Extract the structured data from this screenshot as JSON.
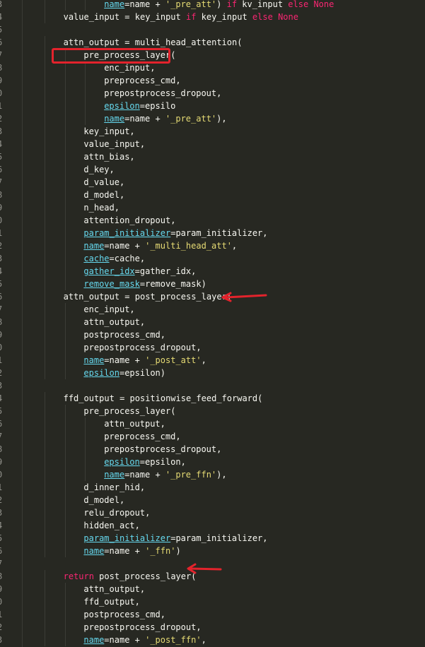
{
  "editor": {
    "language": "python",
    "theme": "dark",
    "colors": {
      "background": "#272822",
      "keyword": "#f92672",
      "param": "#66d9ef",
      "string": "#e6db74",
      "annotation": "#e3232c"
    },
    "line_numbers": [
      "3",
      "4",
      "5",
      "6",
      "7",
      "8",
      "9",
      "0",
      "1",
      "2",
      "3",
      "4",
      "5",
      "6",
      "7",
      "8",
      "9",
      "0",
      "1",
      "2",
      "3",
      "4",
      "5",
      "6",
      "7",
      "8",
      "9",
      "0",
      "1",
      "2",
      "3",
      "4",
      "5",
      "6",
      "7",
      "8",
      "9",
      "0",
      "1",
      "2",
      "3",
      "4",
      "5",
      "6",
      "7",
      "8",
      "9",
      "0",
      "1",
      "2",
      "3",
      "4",
      "5",
      "6"
    ],
    "lines": [
      {
        "indent": 16,
        "segments": [
          {
            "t": "name",
            "c": "param"
          },
          {
            "t": "=name + ",
            "c": "op"
          },
          {
            "t": "'_pre_att'",
            "c": "str"
          },
          {
            "t": ") ",
            "c": "op"
          },
          {
            "t": "if",
            "c": "kw"
          },
          {
            "t": " kv_input ",
            "c": "op"
          },
          {
            "t": "else",
            "c": "kw"
          },
          {
            "t": " ",
            "c": "op"
          },
          {
            "t": "None",
            "c": "kw"
          }
        ]
      },
      {
        "indent": 8,
        "segments": [
          {
            "t": "value_input = key_input ",
            "c": "op"
          },
          {
            "t": "if",
            "c": "kw"
          },
          {
            "t": " key_input ",
            "c": "op"
          },
          {
            "t": "else",
            "c": "kw"
          },
          {
            "t": " ",
            "c": "op"
          },
          {
            "t": "None",
            "c": "kw"
          }
        ]
      },
      {
        "indent": 0,
        "segments": []
      },
      {
        "indent": 8,
        "segments": [
          {
            "t": "attn_output = multi_head_attention(",
            "c": "op"
          }
        ]
      },
      {
        "indent": 12,
        "segments": [
          {
            "t": "pre_process_layer(",
            "c": "op"
          }
        ]
      },
      {
        "indent": 16,
        "segments": [
          {
            "t": "enc_input,",
            "c": "op"
          }
        ]
      },
      {
        "indent": 16,
        "segments": [
          {
            "t": "preprocess_cmd,",
            "c": "op"
          }
        ]
      },
      {
        "indent": 16,
        "segments": [
          {
            "t": "prepostprocess_dropout,",
            "c": "op"
          }
        ]
      },
      {
        "indent": 16,
        "segments": [
          {
            "t": "epsilon",
            "c": "param"
          },
          {
            "t": "=epsilo",
            "c": "op"
          }
        ]
      },
      {
        "indent": 16,
        "segments": [
          {
            "t": "name",
            "c": "param"
          },
          {
            "t": "=name + ",
            "c": "op"
          },
          {
            "t": "'_pre_att'",
            "c": "str"
          },
          {
            "t": "),",
            "c": "op"
          }
        ]
      },
      {
        "indent": 12,
        "segments": [
          {
            "t": "key_input,",
            "c": "op"
          }
        ]
      },
      {
        "indent": 12,
        "segments": [
          {
            "t": "value_input,",
            "c": "op"
          }
        ]
      },
      {
        "indent": 12,
        "segments": [
          {
            "t": "attn_bias,",
            "c": "op"
          }
        ]
      },
      {
        "indent": 12,
        "segments": [
          {
            "t": "d_key,",
            "c": "op"
          }
        ]
      },
      {
        "indent": 12,
        "segments": [
          {
            "t": "d_value,",
            "c": "op"
          }
        ]
      },
      {
        "indent": 12,
        "segments": [
          {
            "t": "d_model,",
            "c": "op"
          }
        ]
      },
      {
        "indent": 12,
        "segments": [
          {
            "t": "n_head,",
            "c": "op"
          }
        ]
      },
      {
        "indent": 12,
        "segments": [
          {
            "t": "attention_dropout,",
            "c": "op"
          }
        ]
      },
      {
        "indent": 12,
        "segments": [
          {
            "t": "param_initializer",
            "c": "param"
          },
          {
            "t": "=param_initializer,",
            "c": "op"
          }
        ]
      },
      {
        "indent": 12,
        "segments": [
          {
            "t": "name",
            "c": "param"
          },
          {
            "t": "=name + ",
            "c": "op"
          },
          {
            "t": "'_multi_head_att'",
            "c": "str"
          },
          {
            "t": ",",
            "c": "op"
          }
        ]
      },
      {
        "indent": 12,
        "segments": [
          {
            "t": "cache",
            "c": "param"
          },
          {
            "t": "=cache,",
            "c": "op"
          }
        ]
      },
      {
        "indent": 12,
        "segments": [
          {
            "t": "gather_idx",
            "c": "param"
          },
          {
            "t": "=gather_idx,",
            "c": "op"
          }
        ]
      },
      {
        "indent": 12,
        "segments": [
          {
            "t": "remove_mask",
            "c": "param"
          },
          {
            "t": "=remove_mask)",
            "c": "op"
          }
        ]
      },
      {
        "indent": 8,
        "segments": [
          {
            "t": "attn_output = post_process_layer(",
            "c": "op"
          }
        ]
      },
      {
        "indent": 12,
        "segments": [
          {
            "t": "enc_input,",
            "c": "op"
          }
        ]
      },
      {
        "indent": 12,
        "segments": [
          {
            "t": "attn_output,",
            "c": "op"
          }
        ]
      },
      {
        "indent": 12,
        "segments": [
          {
            "t": "postprocess_cmd,",
            "c": "op"
          }
        ]
      },
      {
        "indent": 12,
        "segments": [
          {
            "t": "prepostprocess_dropout,",
            "c": "op"
          }
        ]
      },
      {
        "indent": 12,
        "segments": [
          {
            "t": "name",
            "c": "param"
          },
          {
            "t": "=name + ",
            "c": "op"
          },
          {
            "t": "'_post_att'",
            "c": "str"
          },
          {
            "t": ",",
            "c": "op"
          }
        ]
      },
      {
        "indent": 12,
        "segments": [
          {
            "t": "epsilon",
            "c": "param"
          },
          {
            "t": "=epsilon)",
            "c": "op"
          }
        ]
      },
      {
        "indent": 0,
        "segments": []
      },
      {
        "indent": 8,
        "segments": [
          {
            "t": "ffd_output = positionwise_feed_forward(",
            "c": "op"
          }
        ]
      },
      {
        "indent": 12,
        "segments": [
          {
            "t": "pre_process_layer(",
            "c": "op"
          }
        ]
      },
      {
        "indent": 16,
        "segments": [
          {
            "t": "attn_output,",
            "c": "op"
          }
        ]
      },
      {
        "indent": 16,
        "segments": [
          {
            "t": "preprocess_cmd,",
            "c": "op"
          }
        ]
      },
      {
        "indent": 16,
        "segments": [
          {
            "t": "prepostprocess_dropout,",
            "c": "op"
          }
        ]
      },
      {
        "indent": 16,
        "segments": [
          {
            "t": "epsilon",
            "c": "param"
          },
          {
            "t": "=epsilon,",
            "c": "op"
          }
        ]
      },
      {
        "indent": 16,
        "segments": [
          {
            "t": "name",
            "c": "param"
          },
          {
            "t": "=name + ",
            "c": "op"
          },
          {
            "t": "'_pre_ffn'",
            "c": "str"
          },
          {
            "t": "),",
            "c": "op"
          }
        ]
      },
      {
        "indent": 12,
        "segments": [
          {
            "t": "d_inner_hid,",
            "c": "op"
          }
        ]
      },
      {
        "indent": 12,
        "segments": [
          {
            "t": "d_model,",
            "c": "op"
          }
        ]
      },
      {
        "indent": 12,
        "segments": [
          {
            "t": "relu_dropout,",
            "c": "op"
          }
        ]
      },
      {
        "indent": 12,
        "segments": [
          {
            "t": "hidden_act,",
            "c": "op"
          }
        ]
      },
      {
        "indent": 12,
        "segments": [
          {
            "t": "param_initializer",
            "c": "param"
          },
          {
            "t": "=param_initializer,",
            "c": "op"
          }
        ]
      },
      {
        "indent": 12,
        "segments": [
          {
            "t": "name",
            "c": "param"
          },
          {
            "t": "=name + ",
            "c": "op"
          },
          {
            "t": "'_ffn'",
            "c": "str"
          },
          {
            "t": ")",
            "c": "op"
          }
        ]
      },
      {
        "indent": 0,
        "segments": []
      },
      {
        "indent": 8,
        "segments": [
          {
            "t": "return",
            "c": "kw"
          },
          {
            "t": " post_process_layer(",
            "c": "op"
          }
        ]
      },
      {
        "indent": 12,
        "segments": [
          {
            "t": "attn_output,",
            "c": "op"
          }
        ]
      },
      {
        "indent": 12,
        "segments": [
          {
            "t": "ffd_output,",
            "c": "op"
          }
        ]
      },
      {
        "indent": 12,
        "segments": [
          {
            "t": "postprocess_cmd,",
            "c": "op"
          }
        ]
      },
      {
        "indent": 12,
        "segments": [
          {
            "t": "prepostprocess_dropout,",
            "c": "op"
          }
        ]
      },
      {
        "indent": 12,
        "segments": [
          {
            "t": "name",
            "c": "param"
          },
          {
            "t": "=name + ",
            "c": "op"
          },
          {
            "t": "'_post_ffn'",
            "c": "str"
          },
          {
            "t": ",",
            "c": "op"
          }
        ]
      }
    ]
  },
  "annotations": {
    "highlight_box_color": "#e3232c",
    "arrows": [
      "arrow-post-process-att",
      "arrow-return-post-process"
    ]
  }
}
